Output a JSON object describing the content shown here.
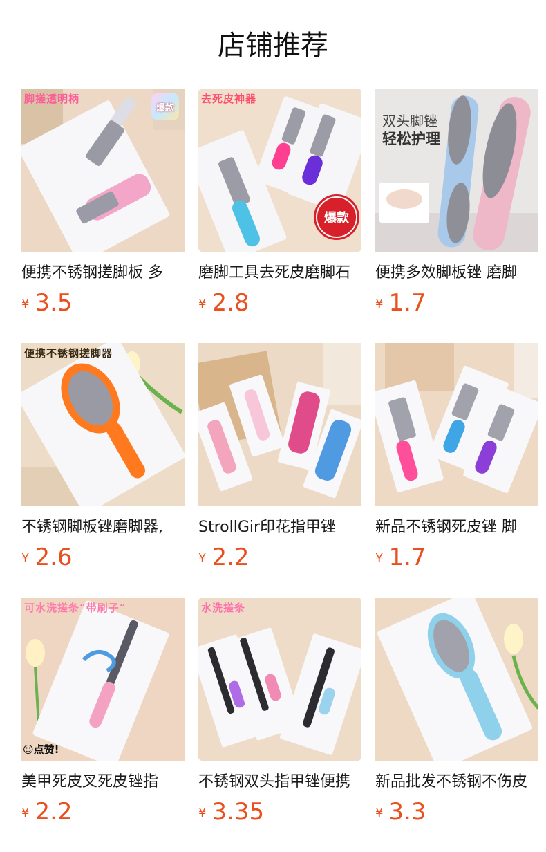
{
  "page_title": "店铺推荐",
  "currency_symbol": "¥",
  "products": [
    {
      "name": "便携不锈钢搓脚板 多",
      "price": "3.5",
      "overlay": "脚搓透明柄",
      "overlay_color": "#ff5c9a",
      "badge": "爆款"
    },
    {
      "name": "磨脚工具去死皮磨脚石",
      "price": "2.8",
      "overlay": "去死皮神器",
      "overlay_color": "#ff4d6d",
      "badge": "爆款"
    },
    {
      "name": "便携多效脚板锉 磨脚",
      "price": "1.7",
      "headline_1": "双头脚锉",
      "headline_2": "轻松护理"
    },
    {
      "name": "不锈钢脚板锉磨脚器,",
      "price": "2.6",
      "overlay": "便携不锈钢搓脚器",
      "overlay_color": "#3a2a10"
    },
    {
      "name": "StrollGir印花指甲锉",
      "price": "2.2"
    },
    {
      "name": "新品不锈钢死皮锉 脚",
      "price": "1.7"
    },
    {
      "name": "美甲死皮叉死皮锉指",
      "price": "2.2",
      "overlay": "可水洗搓条“带刷子”",
      "overlay_color": "#ff7aa8",
      "tag": "点赞!"
    },
    {
      "name": "不锈钢双头指甲锉便携",
      "price": "3.35",
      "overlay": "水洗搓条",
      "overlay_color": "#ff6fa8"
    },
    {
      "name": "新品批发不锈钢不伤皮",
      "price": "3.3"
    }
  ],
  "colors": {
    "price": "#e8501e",
    "background": "#ffffff",
    "photo_bg": "#eddccb"
  }
}
